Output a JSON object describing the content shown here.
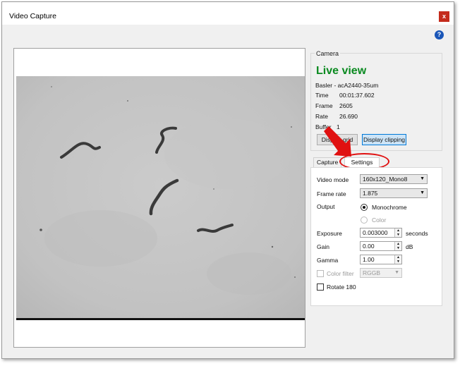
{
  "window": {
    "title": "Video Capture",
    "close_label": "x",
    "help_label": "?"
  },
  "camera": {
    "group_title": "Camera",
    "status": "Live view",
    "model": "Basler - acA2440-35um",
    "time_label": "Time",
    "time_value": "00:01:37.602",
    "frame_label": "Frame",
    "frame_value": "2605",
    "rate_label": "Rate",
    "rate_value": "26.690",
    "buffer_label": "Buffer",
    "buffer_value": "1",
    "display_grid_label": "Display grid",
    "display_clipping_label": "Display clipping"
  },
  "tabs": {
    "capture": "Capture",
    "settings": "Settings"
  },
  "settings": {
    "video_mode_label": "Video mode",
    "video_mode_value": "160x120_Mono8",
    "frame_rate_label": "Frame rate",
    "frame_rate_value": "1.875",
    "output_label": "Output",
    "output_options": [
      "Monochrome",
      "Color"
    ],
    "exposure_label": "Exposure",
    "exposure_value": "0.003000",
    "exposure_unit": "seconds",
    "gain_label": "Gain",
    "gain_value": "0.00",
    "gain_unit": "dB",
    "gamma_label": "Gamma",
    "gamma_value": "1.00",
    "color_filter_label": "Color filter",
    "color_filter_value": "RGGB",
    "rotate_label": "Rotate 180"
  },
  "colors": {
    "live_view": "#0a8a20",
    "annotation": "#e01010",
    "close_button": "#c42b1c"
  }
}
